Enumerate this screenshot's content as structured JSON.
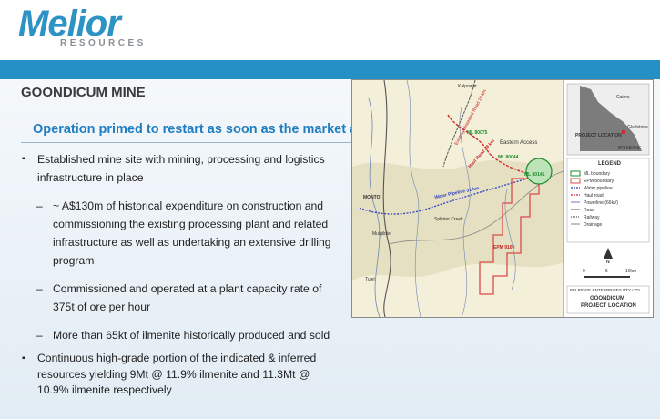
{
  "brand": {
    "name": "Melior",
    "sub": "RESOURCES",
    "color": "#2d93c4"
  },
  "slide": {
    "title": "GOONDICUM MINE",
    "subtitle": "Operation primed to restart as soon as the market allows",
    "bullets": [
      {
        "text": "Established mine site with mining, processing and logistics infrastructure in place"
      },
      {
        "text": "~ A$130m of historical expenditure on construction and commissioning the existing processing plant and related infrastructure as well as undertaking an extensive drilling program"
      },
      {
        "text": "Commissioned and operated at a plant capacity rate of 375t of ore per hour"
      },
      {
        "text": "More than 65kt of ilmenite historically produced and sold"
      },
      {
        "text": "Continuous high-grade portion of the indicated & inferred resources yielding 9Mt @ 11.9% ilmenite and 11.3Mt @ 10.9% ilmenite respectively"
      }
    ],
    "sub_dash": "–"
  },
  "map": {
    "places": {
      "kalpowar": "Kalpowar",
      "monto": "MONTO",
      "mulgildie": "Mulgildie",
      "splinter": "Splinter Creek",
      "eastern_access": "Eastern Access",
      "tulel": "Tulel"
    },
    "labels": {
      "ml1": "ML 80075",
      "ml2": "ML 80044",
      "ml3": "ML 80141",
      "epm": "EPM 9100",
      "water": "Water Pipeline 31 km",
      "haul": "Haul Road 28 km",
      "road": "Existing Unsealed Road 19 km"
    },
    "inset": {
      "location": "PROJECT LOCATION",
      "cairns": "Cairns",
      "gladstone": "Gladstone",
      "brisbane": "BRISBANE"
    },
    "legend": {
      "title": "LEGEND",
      "items": [
        "ML boundary",
        "EPM boundary",
        "Water pipeline",
        "Haul road",
        "Powerline (66kV)",
        "Road",
        "Railway",
        "Drainage"
      ]
    },
    "scale": [
      "0",
      "5",
      "10km"
    ],
    "north": "N",
    "company": "BELRIDGE ENTERPRISES PTY LTD",
    "caption_title": "GOONDICUM",
    "caption_sub": "PROJECT LOCATION",
    "colors": {
      "haul": "#d12a2a",
      "water": "#2a3fc4",
      "ml": "#1c8a2c",
      "epm": "#d94b4b"
    }
  }
}
